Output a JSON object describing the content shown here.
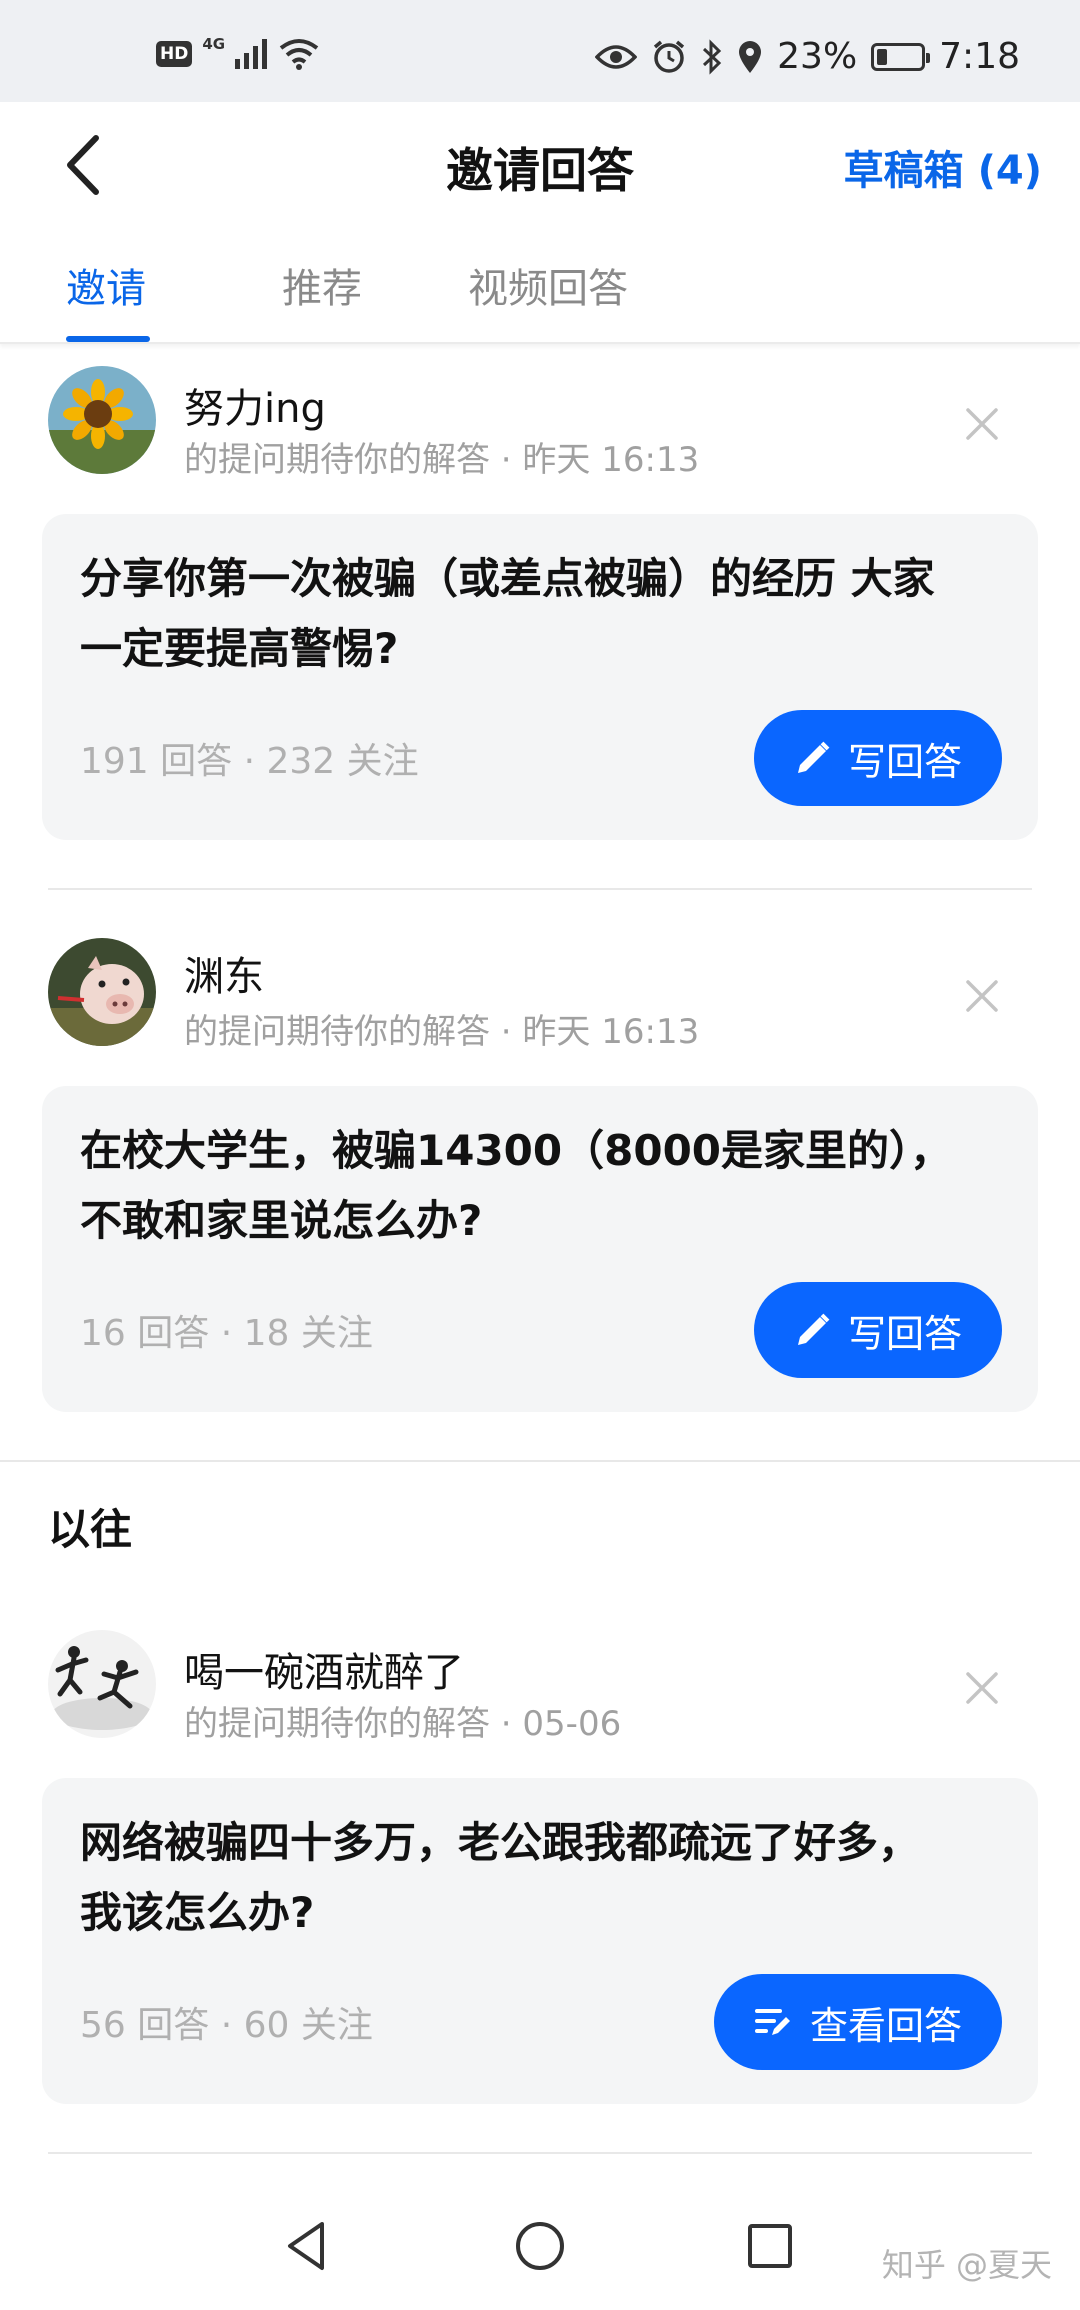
{
  "status_bar": {
    "hd": "HD",
    "network": "4G",
    "battery": "23%",
    "battery_level": 0.23,
    "time": "7:18"
  },
  "header": {
    "title": "邀请回答",
    "drafts": "草稿箱 (4)"
  },
  "tabs": [
    {
      "label": "邀请",
      "active": true
    },
    {
      "label": "推荐",
      "active": false
    },
    {
      "label": "视频回答",
      "active": false
    }
  ],
  "items": [
    {
      "author": "努力ing",
      "meta": "的提问期待你的解答 · 昨天 16:13",
      "question_line1": "分享你第一次被骗（或差点被骗）的经历 大家",
      "question_line2": "一定要提高警惕?",
      "stats": "191 回答 · 232 关注",
      "action": "写回答",
      "action_icon": "pencil-icon"
    },
    {
      "author": "渊东",
      "meta": "的提问期待你的解答 · 昨天 16:13",
      "question_line1": "在校大学生，被骗14300（8000是家里的），",
      "question_line2": "不敢和家里说怎么办?",
      "stats": "16 回答 · 18 关注",
      "action": "写回答",
      "action_icon": "pencil-icon"
    }
  ],
  "past_section": {
    "title": "以往",
    "items": [
      {
        "author": "喝一碗酒就醉了",
        "meta": "的提问期待你的解答 · 05-06",
        "question_line1": "网络被骗四十多万，老公跟我都疏远了好多，",
        "question_line2": "我该怎么办?",
        "stats": "56 回答 · 60 关注",
        "action": "查看回答",
        "action_icon": "list-edit-icon"
      }
    ]
  },
  "watermark": "知乎 @夏天",
  "colors": {
    "accent": "#0a66e8",
    "button": "#0a66ff",
    "card": "#f4f5f6"
  }
}
